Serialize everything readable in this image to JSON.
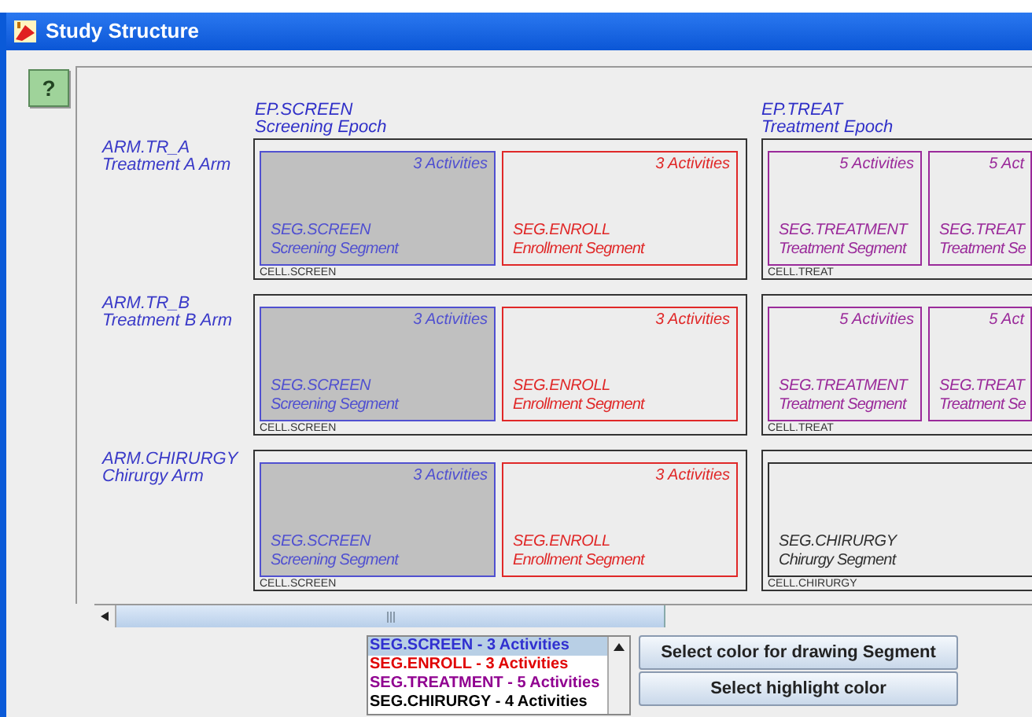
{
  "window": {
    "title": "Study Structure"
  },
  "help_button": {
    "label": "?"
  },
  "epochs": [
    {
      "code": "EP.SCREEN",
      "name": "Screening Epoch"
    },
    {
      "code": "EP.TREAT",
      "name": "Treatment Epoch"
    }
  ],
  "arms": [
    {
      "code": "ARM.TR_A",
      "name": "Treatment A Arm",
      "cells": [
        {
          "label": "CELL.SCREEN",
          "segments": [
            {
              "code": "SEG.SCREEN",
              "name": "Screening Segment",
              "activities": "3 Activities",
              "color": "#5050d0",
              "highlighted": true
            },
            {
              "code": "SEG.ENROLL",
              "name": "Enrollment Segment",
              "activities": "3 Activities",
              "color": "#e02828",
              "highlighted": false
            }
          ]
        },
        {
          "label": "CELL.TREAT",
          "segments": [
            {
              "code": "SEG.TREATMENT",
              "name": "Treatment Segment",
              "activities": "5 Activities",
              "color": "#9a2a9a",
              "highlighted": false
            },
            {
              "code": "SEG.TREAT",
              "name": "Treatment Se",
              "activities": "5 Act",
              "color": "#9a2a9a",
              "highlighted": false
            }
          ]
        }
      ]
    },
    {
      "code": "ARM.TR_B",
      "name": "Treatment B Arm",
      "cells": [
        {
          "label": "CELL.SCREEN",
          "segments": [
            {
              "code": "SEG.SCREEN",
              "name": "Screening Segment",
              "activities": "3 Activities",
              "color": "#5050d0",
              "highlighted": true
            },
            {
              "code": "SEG.ENROLL",
              "name": "Enrollment Segment",
              "activities": "3 Activities",
              "color": "#e02828",
              "highlighted": false
            }
          ]
        },
        {
          "label": "CELL.TREAT",
          "segments": [
            {
              "code": "SEG.TREATMENT",
              "name": "Treatment Segment",
              "activities": "5 Activities",
              "color": "#9a2a9a",
              "highlighted": false
            },
            {
              "code": "SEG.TREAT",
              "name": "Treatment Se",
              "activities": "5 Act",
              "color": "#9a2a9a",
              "highlighted": false
            }
          ]
        }
      ]
    },
    {
      "code": "ARM.CHIRURGY",
      "name": "Chirurgy Arm",
      "cells": [
        {
          "label": "CELL.SCREEN",
          "segments": [
            {
              "code": "SEG.SCREEN",
              "name": "Screening Segment",
              "activities": "3 Activities",
              "color": "#5050d0",
              "highlighted": true
            },
            {
              "code": "SEG.ENROLL",
              "name": "Enrollment Segment",
              "activities": "3 Activities",
              "color": "#e02828",
              "highlighted": false
            }
          ]
        },
        {
          "label": "CELL.CHIRURGY",
          "segments": [
            {
              "code": "SEG.CHIRURGY",
              "name": "Chirurgy Segment",
              "color": "#303030",
              "highlighted": false
            }
          ]
        }
      ]
    }
  ],
  "segment_list": [
    {
      "label": "SEG.SCREEN - 3 Activities",
      "color": "#3030d0",
      "selected": true
    },
    {
      "label": "SEG.ENROLL - 3 Activities",
      "color": "#e00000",
      "selected": false
    },
    {
      "label": "SEG.TREATMENT - 5 Activities",
      "color": "#900090",
      "selected": false
    },
    {
      "label": "SEG.CHIRURGY - 4 Activities",
      "color": "#000000",
      "selected": false
    }
  ],
  "buttons": [
    "Select color for drawing Segment",
    "Select highlight color"
  ]
}
